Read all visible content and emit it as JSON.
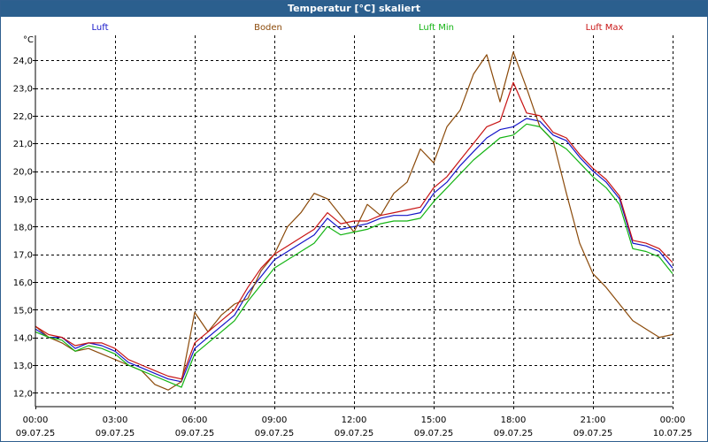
{
  "window": {
    "title": "Temperatur [°C] skaliert"
  },
  "chart_data": {
    "type": "line",
    "unit_label": "°C",
    "grid": true,
    "legend_placement": "top",
    "x_axis": {
      "range": [
        "09.07.25 00:00",
        "10.07.25 00:00"
      ],
      "ticks": [
        {
          "time": "00:00",
          "date": "09.07.25"
        },
        {
          "time": "03:00",
          "date": "09.07.25"
        },
        {
          "time": "06:00",
          "date": "09.07.25"
        },
        {
          "time": "09:00",
          "date": "09.07.25"
        },
        {
          "time": "12:00",
          "date": "09.07.25"
        },
        {
          "time": "15:00",
          "date": "09.07.25"
        },
        {
          "time": "18:00",
          "date": "09.07.25"
        },
        {
          "time": "21:00",
          "date": "09.07.25"
        },
        {
          "time": "00:00",
          "date": "10.07.25"
        }
      ]
    },
    "y_axis": {
      "range": [
        11.5,
        24.9
      ],
      "ticks": [
        "12,0",
        "13,0",
        "14,0",
        "15,0",
        "16,0",
        "17,0",
        "18,0",
        "19,0",
        "20,0",
        "21,0",
        "22,0",
        "23,0",
        "24,0"
      ]
    },
    "series": [
      {
        "name": "Luft",
        "color": "#1414c8",
        "x": [
          "00:00",
          "00:30",
          "01:00",
          "01:30",
          "02:00",
          "02:30",
          "03:00",
          "03:30",
          "04:00",
          "04:30",
          "05:00",
          "05:30",
          "06:00",
          "06:30",
          "07:00",
          "07:30",
          "08:00",
          "08:30",
          "09:00",
          "09:30",
          "10:00",
          "10:30",
          "11:00",
          "11:30",
          "12:00",
          "12:30",
          "13:00",
          "13:30",
          "14:00",
          "14:30",
          "15:00",
          "15:30",
          "16:00",
          "16:30",
          "17:00",
          "17:30",
          "18:00",
          "18:30",
          "19:00",
          "19:30",
          "20:00",
          "20:30",
          "21:00",
          "21:30",
          "22:00",
          "22:30",
          "23:00",
          "23:30",
          "24:00"
        ],
        "y": [
          14.3,
          14.0,
          14.0,
          13.6,
          13.8,
          13.7,
          13.5,
          13.1,
          12.9,
          12.7,
          12.5,
          12.4,
          13.6,
          14.0,
          14.4,
          14.8,
          15.6,
          16.2,
          16.8,
          17.1,
          17.4,
          17.7,
          18.3,
          17.9,
          18.0,
          18.1,
          18.3,
          18.4,
          18.4,
          18.5,
          19.2,
          19.6,
          20.2,
          20.7,
          21.2,
          21.5,
          21.6,
          21.9,
          21.8,
          21.3,
          21.1,
          20.5,
          20.0,
          19.6,
          19.0,
          17.4,
          17.3,
          17.1,
          16.5
        ]
      },
      {
        "name": "Boden",
        "color": "#8b4a0a",
        "x": [
          "00:00",
          "00:30",
          "01:00",
          "01:30",
          "02:00",
          "02:30",
          "03:00",
          "03:30",
          "04:00",
          "04:30",
          "05:00",
          "05:30",
          "06:00",
          "06:30",
          "07:00",
          "07:30",
          "08:00",
          "08:30",
          "09:00",
          "09:30",
          "10:00",
          "10:30",
          "11:00",
          "11:30",
          "12:00",
          "12:30",
          "13:00",
          "13:30",
          "14:00",
          "14:30",
          "15:00",
          "15:30",
          "16:00",
          "16:30",
          "17:00",
          "17:30",
          "18:00",
          "18:30",
          "19:00",
          "19:30",
          "20:00",
          "20:30",
          "21:00",
          "21:30",
          "22:00",
          "22:30",
          "23:00",
          "23:30",
          "24:00"
        ],
        "y": [
          14.4,
          14.0,
          13.8,
          13.5,
          13.6,
          13.4,
          13.2,
          13.0,
          12.8,
          12.3,
          12.1,
          12.4,
          14.9,
          14.2,
          14.8,
          15.2,
          15.4,
          16.4,
          17.0,
          18.0,
          18.5,
          19.2,
          19.0,
          18.4,
          17.8,
          18.8,
          18.4,
          19.2,
          19.6,
          20.8,
          20.3,
          21.6,
          22.2,
          23.5,
          24.2,
          22.5,
          24.3,
          23.0,
          21.6,
          21.1,
          19.2,
          17.4,
          16.3,
          15.8,
          15.2,
          14.6,
          14.3,
          14.0,
          14.1
        ]
      },
      {
        "name": "Luft Min",
        "color": "#14b414",
        "x": [
          "00:00",
          "00:30",
          "01:00",
          "01:30",
          "02:00",
          "02:30",
          "03:00",
          "03:30",
          "04:00",
          "04:30",
          "05:00",
          "05:30",
          "06:00",
          "06:30",
          "07:00",
          "07:30",
          "08:00",
          "08:30",
          "09:00",
          "09:30",
          "10:00",
          "10:30",
          "11:00",
          "11:30",
          "12:00",
          "12:30",
          "13:00",
          "13:30",
          "14:00",
          "14:30",
          "15:00",
          "15:30",
          "16:00",
          "16:30",
          "17:00",
          "17:30",
          "18:00",
          "18:30",
          "19:00",
          "19:30",
          "20:00",
          "20:30",
          "21:00",
          "21:30",
          "22:00",
          "22:30",
          "23:00",
          "23:30",
          "24:00"
        ],
        "y": [
          14.2,
          14.0,
          13.9,
          13.5,
          13.7,
          13.6,
          13.4,
          13.0,
          12.8,
          12.6,
          12.4,
          12.2,
          13.4,
          13.8,
          14.2,
          14.6,
          15.3,
          15.9,
          16.5,
          16.8,
          17.1,
          17.4,
          18.0,
          17.7,
          17.8,
          17.9,
          18.1,
          18.2,
          18.2,
          18.3,
          18.9,
          19.4,
          19.9,
          20.4,
          20.8,
          21.2,
          21.3,
          21.7,
          21.6,
          21.1,
          20.8,
          20.3,
          19.8,
          19.4,
          18.8,
          17.2,
          17.1,
          16.9,
          16.3
        ]
      },
      {
        "name": "Luft Max",
        "color": "#c81414",
        "x": [
          "00:00",
          "00:30",
          "01:00",
          "01:30",
          "02:00",
          "02:30",
          "03:00",
          "03:30",
          "04:00",
          "04:30",
          "05:00",
          "05:30",
          "06:00",
          "06:30",
          "07:00",
          "07:30",
          "08:00",
          "08:30",
          "09:00",
          "09:30",
          "10:00",
          "10:30",
          "11:00",
          "11:30",
          "12:00",
          "12:30",
          "13:00",
          "13:30",
          "14:00",
          "14:30",
          "15:00",
          "15:30",
          "16:00",
          "16:30",
          "17:00",
          "17:30",
          "18:00",
          "18:30",
          "19:00",
          "19:30",
          "20:00",
          "20:30",
          "21:00",
          "21:30",
          "22:00",
          "22:30",
          "23:00",
          "23:30",
          "24:00"
        ],
        "y": [
          14.4,
          14.1,
          14.0,
          13.7,
          13.8,
          13.8,
          13.6,
          13.2,
          13.0,
          12.8,
          12.6,
          12.5,
          13.8,
          14.2,
          14.6,
          15.0,
          15.8,
          16.5,
          17.0,
          17.3,
          17.6,
          17.9,
          18.5,
          18.1,
          18.2,
          18.2,
          18.4,
          18.5,
          18.6,
          18.7,
          19.4,
          19.8,
          20.4,
          21.0,
          21.6,
          21.8,
          23.2,
          22.1,
          22.0,
          21.4,
          21.2,
          20.6,
          20.1,
          19.7,
          19.1,
          17.5,
          17.4,
          17.2,
          16.7
        ]
      }
    ]
  }
}
